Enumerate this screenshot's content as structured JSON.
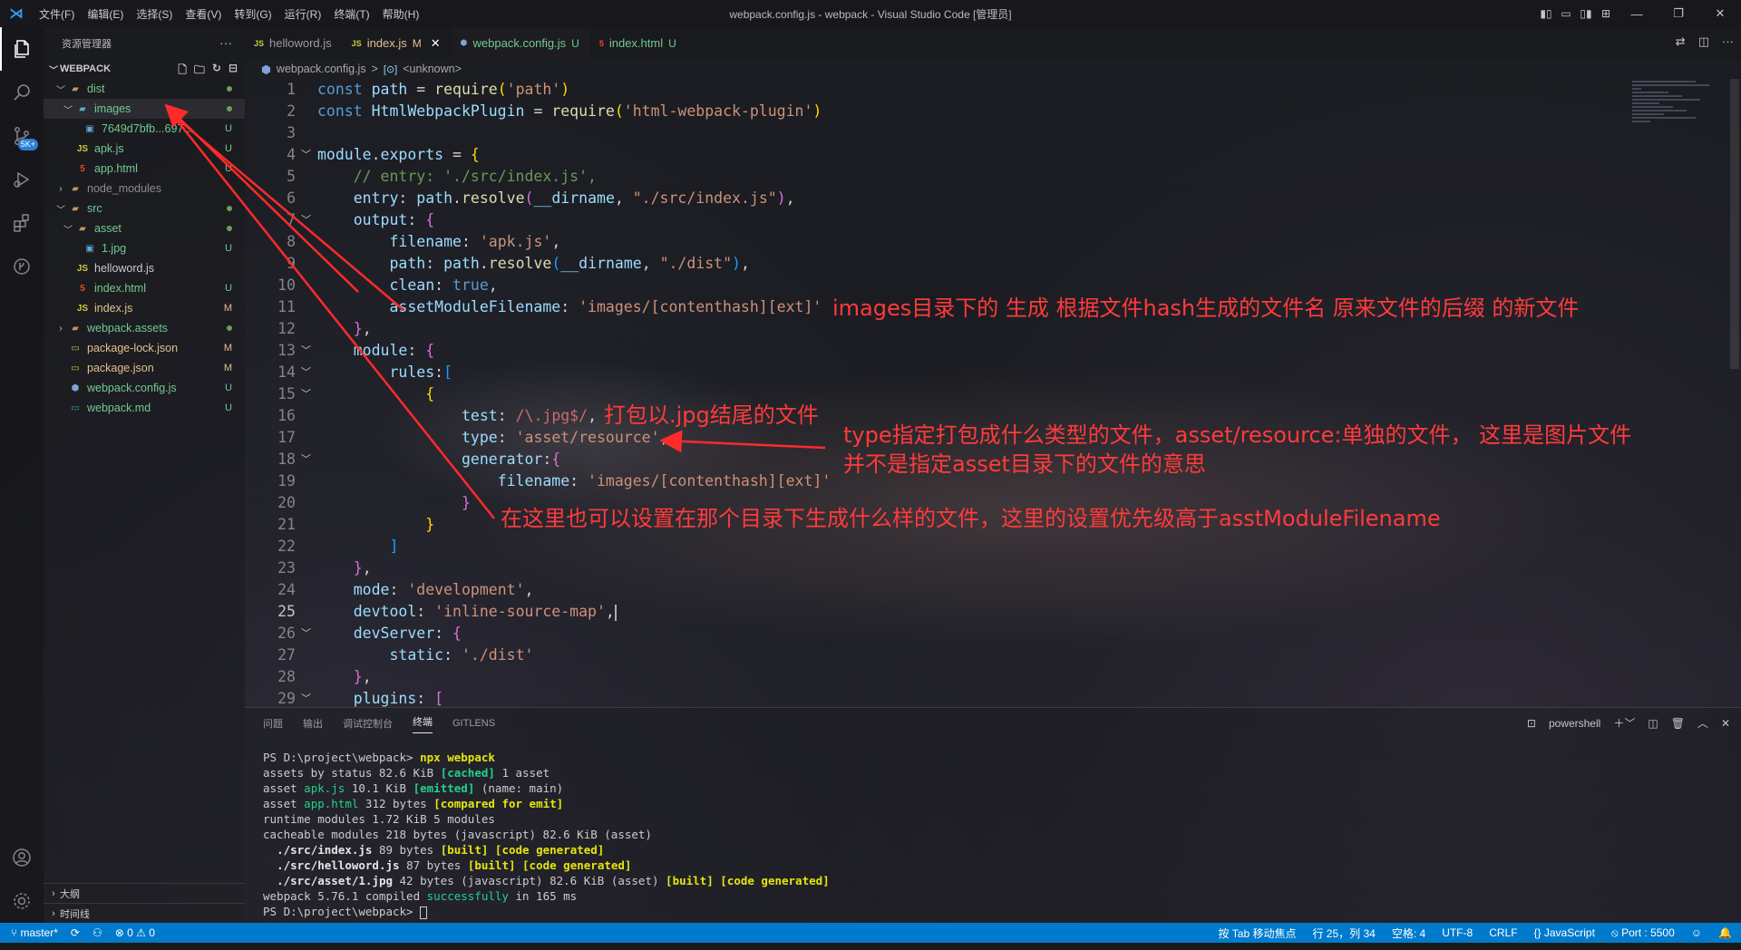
{
  "titlebar": {
    "menu": [
      "文件(F)",
      "编辑(E)",
      "选择(S)",
      "查看(V)",
      "转到(G)",
      "运行(R)",
      "终端(T)",
      "帮助(H)"
    ],
    "title": "webpack.config.js - webpack - Visual Studio Code [管理员]"
  },
  "activitybar": {
    "badge": "5K+"
  },
  "sidebar": {
    "header": "资源管理器",
    "section": "WEBPACK",
    "tree": [
      {
        "name": "dist",
        "status": ""
      },
      {
        "name": "images",
        "status": ""
      },
      {
        "name": "7649d7bfb...697...",
        "status": "U"
      },
      {
        "name": "apk.js",
        "status": "U"
      },
      {
        "name": "app.html",
        "status": "U"
      },
      {
        "name": "node_modules",
        "status": ""
      },
      {
        "name": "src",
        "status": ""
      },
      {
        "name": "asset",
        "status": ""
      },
      {
        "name": "1.jpg",
        "status": "U"
      },
      {
        "name": "helloword.js",
        "status": ""
      },
      {
        "name": "index.html",
        "status": "U"
      },
      {
        "name": "index.js",
        "status": "M"
      },
      {
        "name": "webpack.assets",
        "status": ""
      },
      {
        "name": "package-lock.json",
        "status": "M"
      },
      {
        "name": "package.json",
        "status": "M"
      },
      {
        "name": "webpack.config.js",
        "status": "U"
      },
      {
        "name": "webpack.md",
        "status": "U"
      }
    ],
    "outline": "大纲",
    "timeline": "时间线"
  },
  "tabs": [
    {
      "tag": "JS",
      "label": "helloword.js",
      "flag": ""
    },
    {
      "tag": "JS",
      "label": "index.js",
      "flag": "M"
    },
    {
      "tag": "⬢",
      "label": "webpack.config.js",
      "flag": "U"
    },
    {
      "tag": "5",
      "label": "index.html",
      "flag": "U"
    }
  ],
  "breadcrumb": {
    "file": "webpack.config.js",
    "sep": ">",
    "symbol": "<unknown>"
  },
  "code": {
    "line_numbers": [
      "1",
      "2",
      "3",
      "4",
      "5",
      "6",
      "7",
      "8",
      "9",
      "10",
      "11",
      "12",
      "13",
      "14",
      "15",
      "16",
      "17",
      "18",
      "19",
      "20",
      "21",
      "22",
      "23",
      "24",
      "25",
      "26",
      "27",
      "28",
      "29"
    ],
    "current_line": "25"
  },
  "annotations": {
    "note1": "images目录下的 生成 根据文件hash生成的文件名 原来文件的后缀 的新文件",
    "note2": "打包以.jpg结尾的文件",
    "note3a": "type指定打包成什么类型的文件，asset/resource:单独的文件， 这里是图片文件",
    "note3b": "并不是指定asset目录下的文件的意思",
    "note4": "在这里也可以设置在那个目录下生成什么样的文件，这里的设置优先级高于asstModuleFilename"
  },
  "panel": {
    "tabs": [
      "问题",
      "输出",
      "调试控制台",
      "终端",
      "GITLENS"
    ],
    "shell": "powershell"
  },
  "terminal": {
    "prompt": "PS D:\\project\\webpack>",
    "command": "npx webpack",
    "lines": {
      "l1": "assets by status 82.6 KiB",
      "l1b": "[cached]",
      "l1c": "1 asset",
      "l2a": "asset",
      "l2b": "apk.js",
      "l2c": "10.1 KiB",
      "l2d": "[emitted]",
      "l2e": "(name: main)",
      "l3a": "asset",
      "l3b": "app.html",
      "l3c": "312 bytes",
      "l3d": "[compared for emit]",
      "l4": "runtime modules 1.72 KiB 5 modules",
      "l5": "cacheable modules 218 bytes (javascript) 82.6 KiB (asset)",
      "l6a": "./src/index.js",
      "l6b": "89 bytes",
      "l7a": "./src/helloword.js",
      "l7b": "87 bytes",
      "l8a": "./src/asset/1.jpg",
      "l8b": "42 bytes (javascript) 82.6 KiB (asset)",
      "built": "[built]",
      "generated": "[code generated]",
      "l9a": "webpack 5.76.1 compiled",
      "l9b": "successfully",
      "l9c": "in 165 ms"
    }
  },
  "statusbar": {
    "branch": "master*",
    "problems": "⊗ 0 ⚠ 0",
    "tab_focus": "按 Tab 移动焦点",
    "position": "行 25，列 34",
    "spaces": "空格: 4",
    "encoding": "UTF-8",
    "eol": "CRLF",
    "language": "{} JavaScript",
    "port": "⦸ Port : 5500"
  }
}
